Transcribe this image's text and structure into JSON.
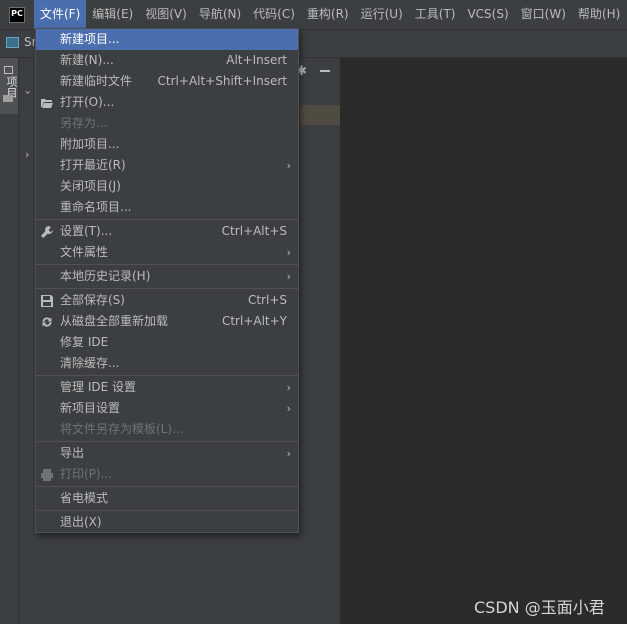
{
  "menubar": {
    "logo": "PC",
    "items": [
      "文件(F)",
      "编辑(E)",
      "视图(V)",
      "导航(N)",
      "代码(C)",
      "重构(R)",
      "运行(U)",
      "工具(T)",
      "VCS(S)",
      "窗口(W)",
      "帮助(H)"
    ]
  },
  "toolbar": {
    "project_crumb": "Sn"
  },
  "sidebar": {
    "project_tab": "项目"
  },
  "menu": {
    "new_project": "新建项目...",
    "new": "新建(N)...",
    "new_shortcut": "Alt+Insert",
    "new_scratch": "新建临时文件",
    "new_scratch_shortcut": "Ctrl+Alt+Shift+Insert",
    "open": "打开(O)...",
    "save_as": "另存为...",
    "attach_project": "附加项目...",
    "open_recent": "打开最近(R)",
    "close_project": "关闭项目(J)",
    "rename_project": "重命名项目...",
    "settings": "设置(T)...",
    "settings_shortcut": "Ctrl+Alt+S",
    "file_properties": "文件属性",
    "local_history": "本地历史记录(H)",
    "save_all": "全部保存(S)",
    "save_all_shortcut": "Ctrl+S",
    "reload_all": "从磁盘全部重新加载",
    "reload_all_shortcut": "Ctrl+Alt+Y",
    "repair_ide": "修复 IDE",
    "invalidate_caches": "清除缓存...",
    "manage_ide_settings": "管理 IDE 设置",
    "new_project_settings": "新项目设置",
    "save_as_template": "将文件另存为模板(L)...",
    "export": "导出",
    "print": "打印(P)...",
    "power_save": "省电模式",
    "exit": "退出(X)"
  },
  "watermark": "CSDN @玉面小君",
  "colors": {
    "highlight": "#4b6eaf",
    "menu_bg": "#3c3f41",
    "editor_bg": "#2b2b2b"
  }
}
